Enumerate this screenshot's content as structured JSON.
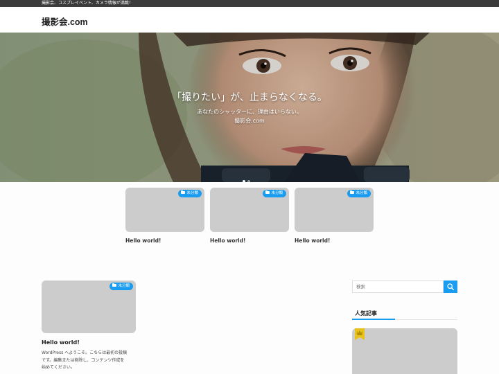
{
  "topbar": {
    "text": "撮影会、コスプレイベント、カメラ情報が満載！"
  },
  "header": {
    "site_title": "撮影会.com"
  },
  "hero": {
    "headline": "「撮りたい」が、止まらなくなる。",
    "sub_line_1": "あなたのシャッターに、理由はいらない。",
    "sub_line_2": "撮影会.com",
    "slides_total": 2,
    "active_slide": 1
  },
  "pickup_cards": [
    {
      "category": "未分類",
      "title": "Hello world!"
    },
    {
      "category": "未分類",
      "title": "Hello world!"
    },
    {
      "category": "未分類",
      "title": "Hello world!"
    }
  ],
  "main_post": {
    "category": "未分類",
    "title": "Hello world!",
    "excerpt_lines": [
      "WordPress へようこそ。こちらは最初の投稿",
      "です。編集または削除し、コンテンツ作成を",
      "始めてください。"
    ]
  },
  "sidebar": {
    "search_placeholder": "検索",
    "popular_title": "人気記事"
  },
  "colors": {
    "accent": "#1a9cf0",
    "topbar_bg": "#3b3b3b",
    "thumb_placeholder": "#cccccc",
    "rank_gold": "#e8c21a"
  },
  "icons": {
    "category_badge": "folder-icon",
    "search_button": "search-icon",
    "rank": "crown-icon"
  }
}
